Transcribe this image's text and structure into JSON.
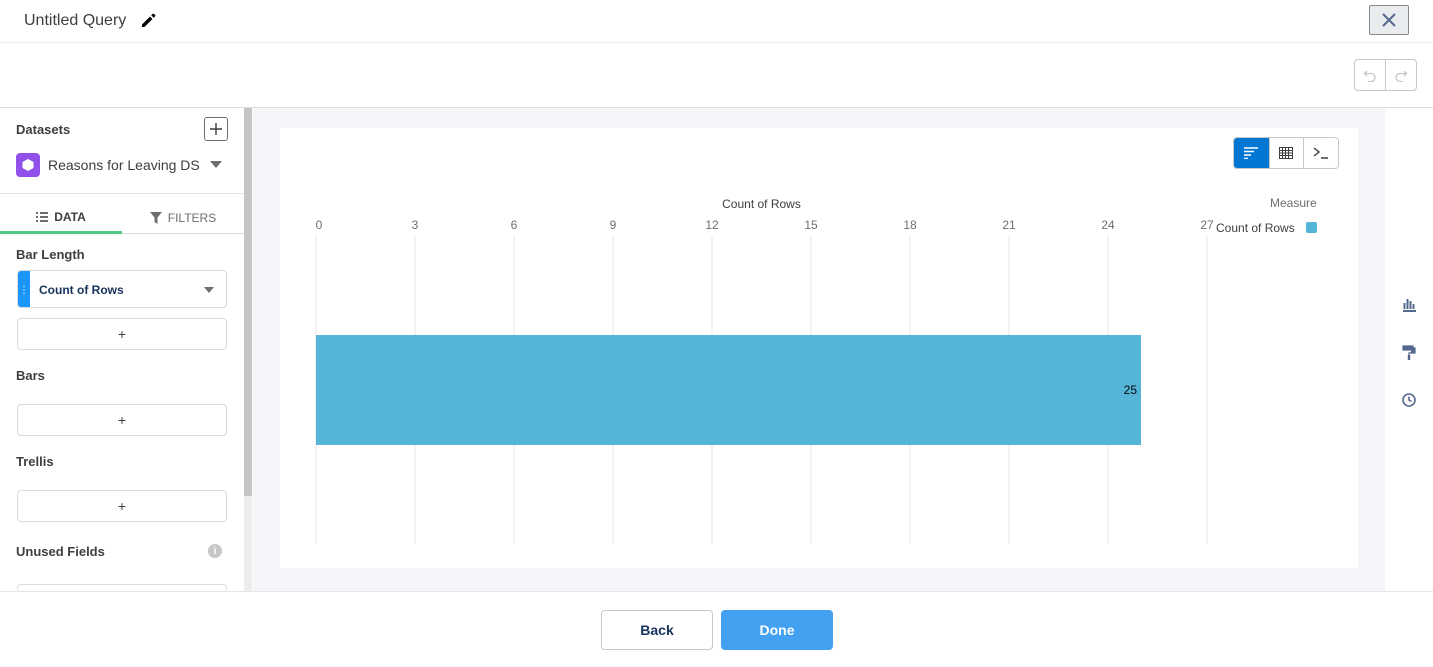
{
  "header": {
    "title": "Untitled Query"
  },
  "left_panel": {
    "datasets_label": "Datasets",
    "dataset_name": "Reasons for Leaving DS",
    "tabs": [
      {
        "label": "DATA"
      },
      {
        "label": "FILTERS"
      }
    ],
    "sections": {
      "bar_length": "Bar Length",
      "bar_length_field": "Count of Rows",
      "bars": "Bars",
      "trellis": "Trellis",
      "unused_fields": "Unused Fields",
      "add_symbol": "+"
    }
  },
  "legend": {
    "title": "Measure",
    "item": "Count of Rows"
  },
  "footer": {
    "back_label": "Back",
    "done_label": "Done"
  },
  "colors": {
    "bar": "#54b5d9",
    "accent": "#0176d3",
    "done": "#44a0f0"
  },
  "icons": [
    "pencil-icon",
    "close-icon",
    "undo-icon",
    "redo-icon",
    "add-icon",
    "dataset-icon",
    "list-icon",
    "filter-icon",
    "bar-chart-icon",
    "table-icon",
    "query-icon",
    "chart-type-icon",
    "format-icon",
    "history-icon",
    "info-icon"
  ],
  "chart_data": {
    "type": "bar",
    "orientation": "horizontal",
    "xlabel": "Count of Rows",
    "xlim": [
      0,
      27
    ],
    "ticks": [
      "0",
      "3",
      "6",
      "9",
      "12",
      "15",
      "18",
      "21",
      "24",
      "27"
    ],
    "categories": [
      ""
    ],
    "series": [
      {
        "name": "Count of Rows",
        "values": [
          25
        ]
      }
    ],
    "data_labels": [
      "25"
    ],
    "grid": true,
    "legend_position": "top-right"
  }
}
